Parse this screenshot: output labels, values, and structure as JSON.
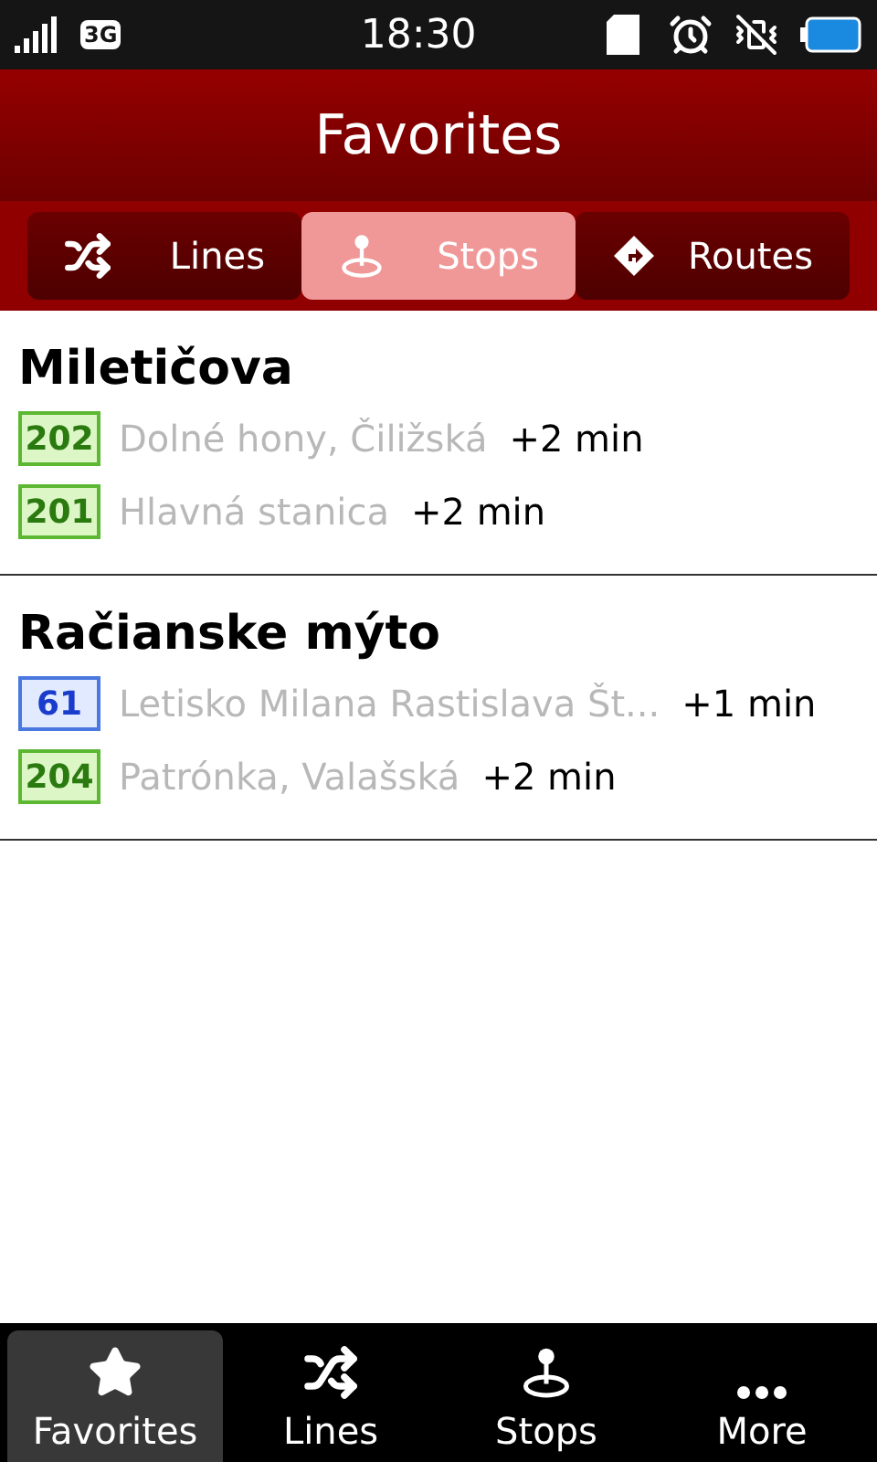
{
  "status_bar": {
    "network": "3G",
    "time": "18:30"
  },
  "header": {
    "title": "Favorites"
  },
  "tabs": [
    {
      "label": "Lines",
      "kind": "shuffle",
      "selected": false
    },
    {
      "label": "Stops",
      "kind": "stop",
      "selected": true
    },
    {
      "label": "Routes",
      "kind": "route",
      "selected": false
    }
  ],
  "stops": [
    {
      "name": "Miletičova",
      "departures": [
        {
          "line": "202",
          "color": "#5cb832",
          "destination": "Dolné hony, Čiližská",
          "delay": "+2 min"
        },
        {
          "line": "201",
          "color": "#5cb832",
          "destination": "Hlavná stanica",
          "delay": "+2 min"
        }
      ]
    },
    {
      "name": "Račianske mýto",
      "departures": [
        {
          "line": "61",
          "color": "#4a78e0",
          "destination": "Letisko Milana Rastislava Št...",
          "delay": "+1 min"
        },
        {
          "line": "204",
          "color": "#5cb832",
          "destination": "Patrónka, Valašská",
          "delay": "+2 min"
        }
      ]
    }
  ],
  "bottom_nav": [
    {
      "label": "Favorites",
      "kind": "star",
      "selected": true
    },
    {
      "label": "Lines",
      "kind": "shuffle",
      "selected": false
    },
    {
      "label": "Stops",
      "kind": "stop",
      "selected": false
    },
    {
      "label": "More",
      "kind": "dots",
      "selected": false
    }
  ]
}
